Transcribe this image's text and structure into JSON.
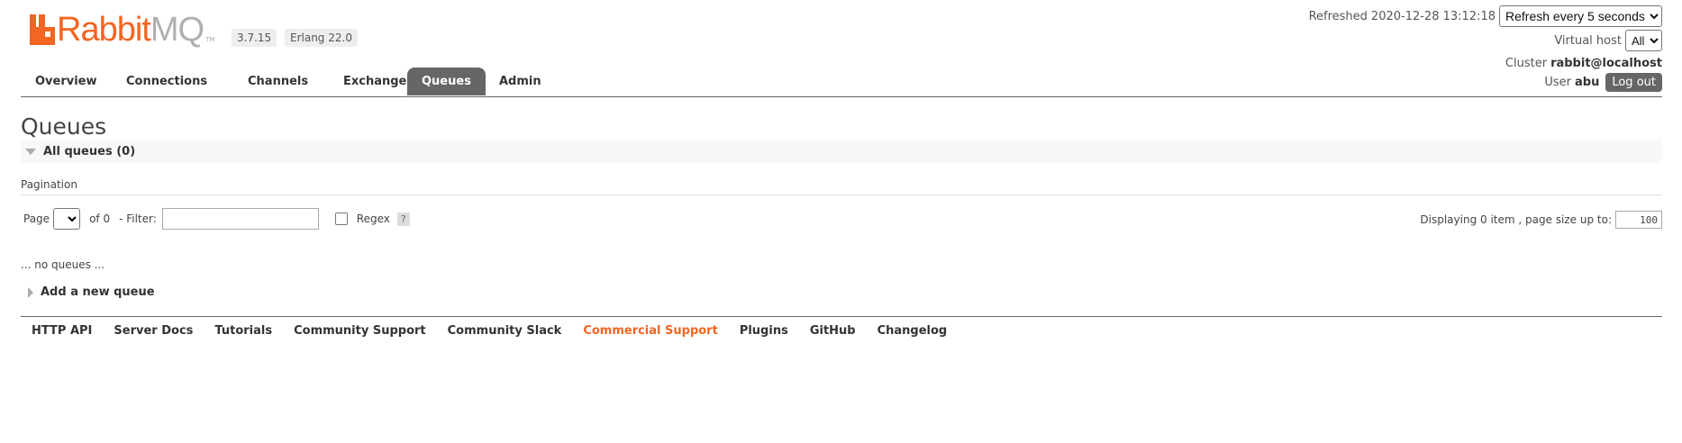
{
  "brand": {
    "name_part1": "Rabbit",
    "name_part2": "MQ",
    "tm": "TM",
    "version": "3.7.15",
    "erlang": "Erlang 22.0"
  },
  "status": {
    "refreshed_label": "Refreshed",
    "refreshed_time": "2020-12-28 13:12:18",
    "refresh_select": "Refresh every 5 seconds",
    "vhost_label": "Virtual host",
    "vhost_value": "All",
    "cluster_label": "Cluster",
    "cluster_value": "rabbit@localhost",
    "user_label": "User",
    "user_value": "abu",
    "logout": "Log out"
  },
  "nav": {
    "tabs": [
      "Overview",
      "Connections",
      "Channels",
      "Exchanges",
      "Queues",
      "Admin"
    ],
    "active": "Queues"
  },
  "main": {
    "title": "Queues",
    "section": "All queues (0)",
    "pagination_label": "Pagination",
    "page_label": "Page",
    "of_label": "of 0",
    "filter_label": "- Filter:",
    "filter_value": "",
    "regex_label": "Regex",
    "help": "?",
    "displaying": "Displaying 0 item , page size up to:",
    "page_size": "100",
    "empty": "... no queues ...",
    "add_queue": "Add a new queue"
  },
  "footer": {
    "links": [
      "HTTP API",
      "Server Docs",
      "Tutorials",
      "Community Support",
      "Community Slack",
      "Commercial Support",
      "Plugins",
      "GitHub",
      "Changelog"
    ],
    "accent_link": "Commercial Support"
  },
  "colors": {
    "brand_orange": "#f26522",
    "nav_active": "#666666"
  }
}
